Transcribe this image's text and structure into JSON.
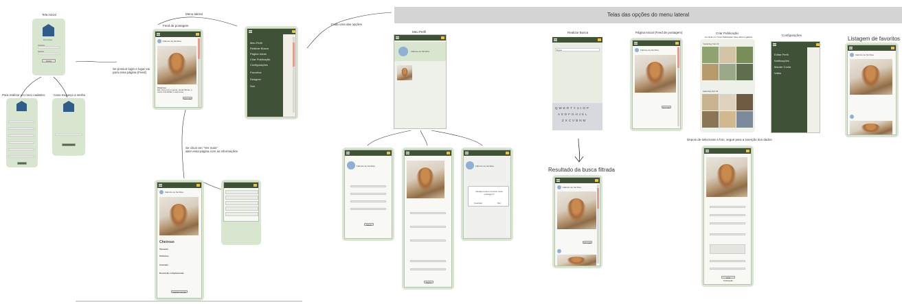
{
  "labels": {
    "tela_inicial": "Tela inicial",
    "menu_lateral": "Menu lateral",
    "feed": "Feed de postagem",
    "cada_uma": "Cada uma das opções",
    "se_possuir": "Se possuir login e logar vai\npara essa página (Feed)",
    "novo_cadastro": "Para realizar um novo cadastro",
    "esqueca_senha": "Caso esqueça a senha",
    "clicar_ver_mais": "Se clicar em \"Ver mais\"\nabre essa página com as informações",
    "telas_opcoes": "Telas das opções do menu lateral",
    "meu_perfil": "Meu Perfil",
    "realizar_busca": "Realizar Busca",
    "pagina_inicial": "Página Inicial (Feed de postagem)",
    "criar_publicacao": "Criar Publicação",
    "criar_pub_sub": "Ao clicar em \"Criar Publicação\" abre direto a galeria",
    "configuracoes": "Configurações",
    "listagem_favoritos": "Listagem de favoritos",
    "resultado_busca": "Resultado da busca filtrada",
    "depois_selecionar": "Depois de selecionar a foto, segue para a inserção dos dados"
  },
  "menu": {
    "items": [
      "Meu Perfil",
      "Realizar Busca",
      "Página Inicial",
      "Criar Publicação",
      "Configurações",
      "Favoritos",
      "Designer",
      "Sair"
    ]
  },
  "config": {
    "items": [
      "Editar Perfil",
      "Notificações",
      "Manter Conta",
      "Voltar"
    ]
  },
  "login": {
    "logo_text": "Pet Adote",
    "usuario": "Usuário",
    "senha": "Senha",
    "entrar": "Entrar"
  },
  "post": {
    "user": "Fabrício de Sá Silva",
    "ver_mais": "Ver mais",
    "nome": "Cheiroso",
    "descricao": "Ele mora com a gente, ainda filhote, é muito brincalhão e atencioso."
  },
  "perfil": {
    "nome": "Fabrício de Sá Silva",
    "salvar": "Salvar"
  },
  "detalhe": {
    "titulo": "Cheiroso",
    "campos": [
      "Tamanho",
      "Sintomas",
      "Castrado",
      "Descrição complementar"
    ],
    "solicitar": "Solicitar Adoção"
  },
  "dialogo": {
    "pergunta": "Deseja mesmo remover essa postagem?",
    "cancelar": "Cancelar",
    "sim": "Sim"
  },
  "busca": {
    "placeholder": "Buscar",
    "keyboard_rows": [
      "Q W E R T Y U I O P",
      "A S D F G H J K L",
      "Z X C V B N M"
    ]
  },
  "galeria": {
    "grupo1": "Yesterday Feb 23",
    "grupo2": "Saturday Feb 18"
  },
  "publicar": {
    "botao": "Criar Publicação"
  }
}
